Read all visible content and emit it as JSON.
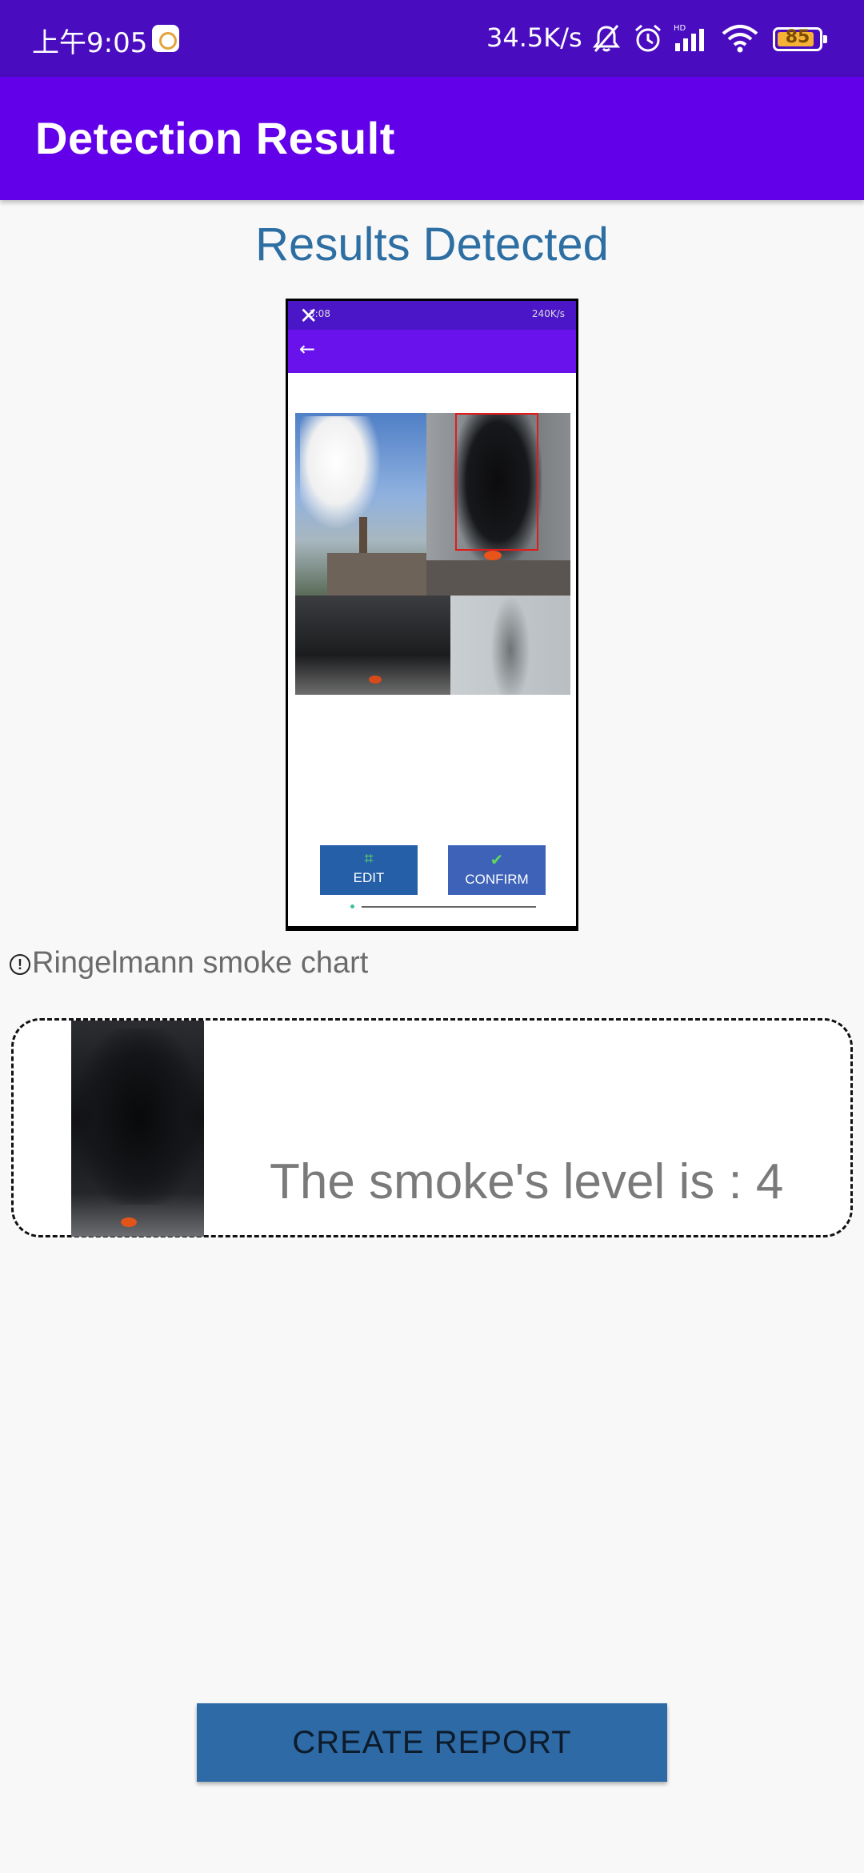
{
  "status_bar": {
    "time": "上午9:05",
    "net_speed": "34.5K/s",
    "battery": "85",
    "icons": [
      "app-notification-icon",
      "mute-icon",
      "alarm-icon",
      "signal-icon",
      "wifi-icon",
      "battery-icon"
    ]
  },
  "app_bar": {
    "title": "Detection Result"
  },
  "heading": "Results Detected",
  "preview": {
    "status_time": "3:08",
    "status_speed": "240K/s",
    "edit_label": "EDIT",
    "confirm_label": "CONFIRM",
    "icons": [
      "close-icon",
      "back-arrow-icon",
      "crop-icon",
      "check-icon"
    ]
  },
  "info": {
    "text": "Ringelmann smoke chart"
  },
  "result": {
    "text": "The smoke's level is : 4"
  },
  "actions": {
    "create_report": "CREATE REPORT"
  },
  "colors": {
    "status_bar": "#4a0cbf",
    "app_bar": "#6200ea",
    "heading": "#2d6ea3",
    "button": "#2d6aa6",
    "bbox": "#e01b1b"
  }
}
